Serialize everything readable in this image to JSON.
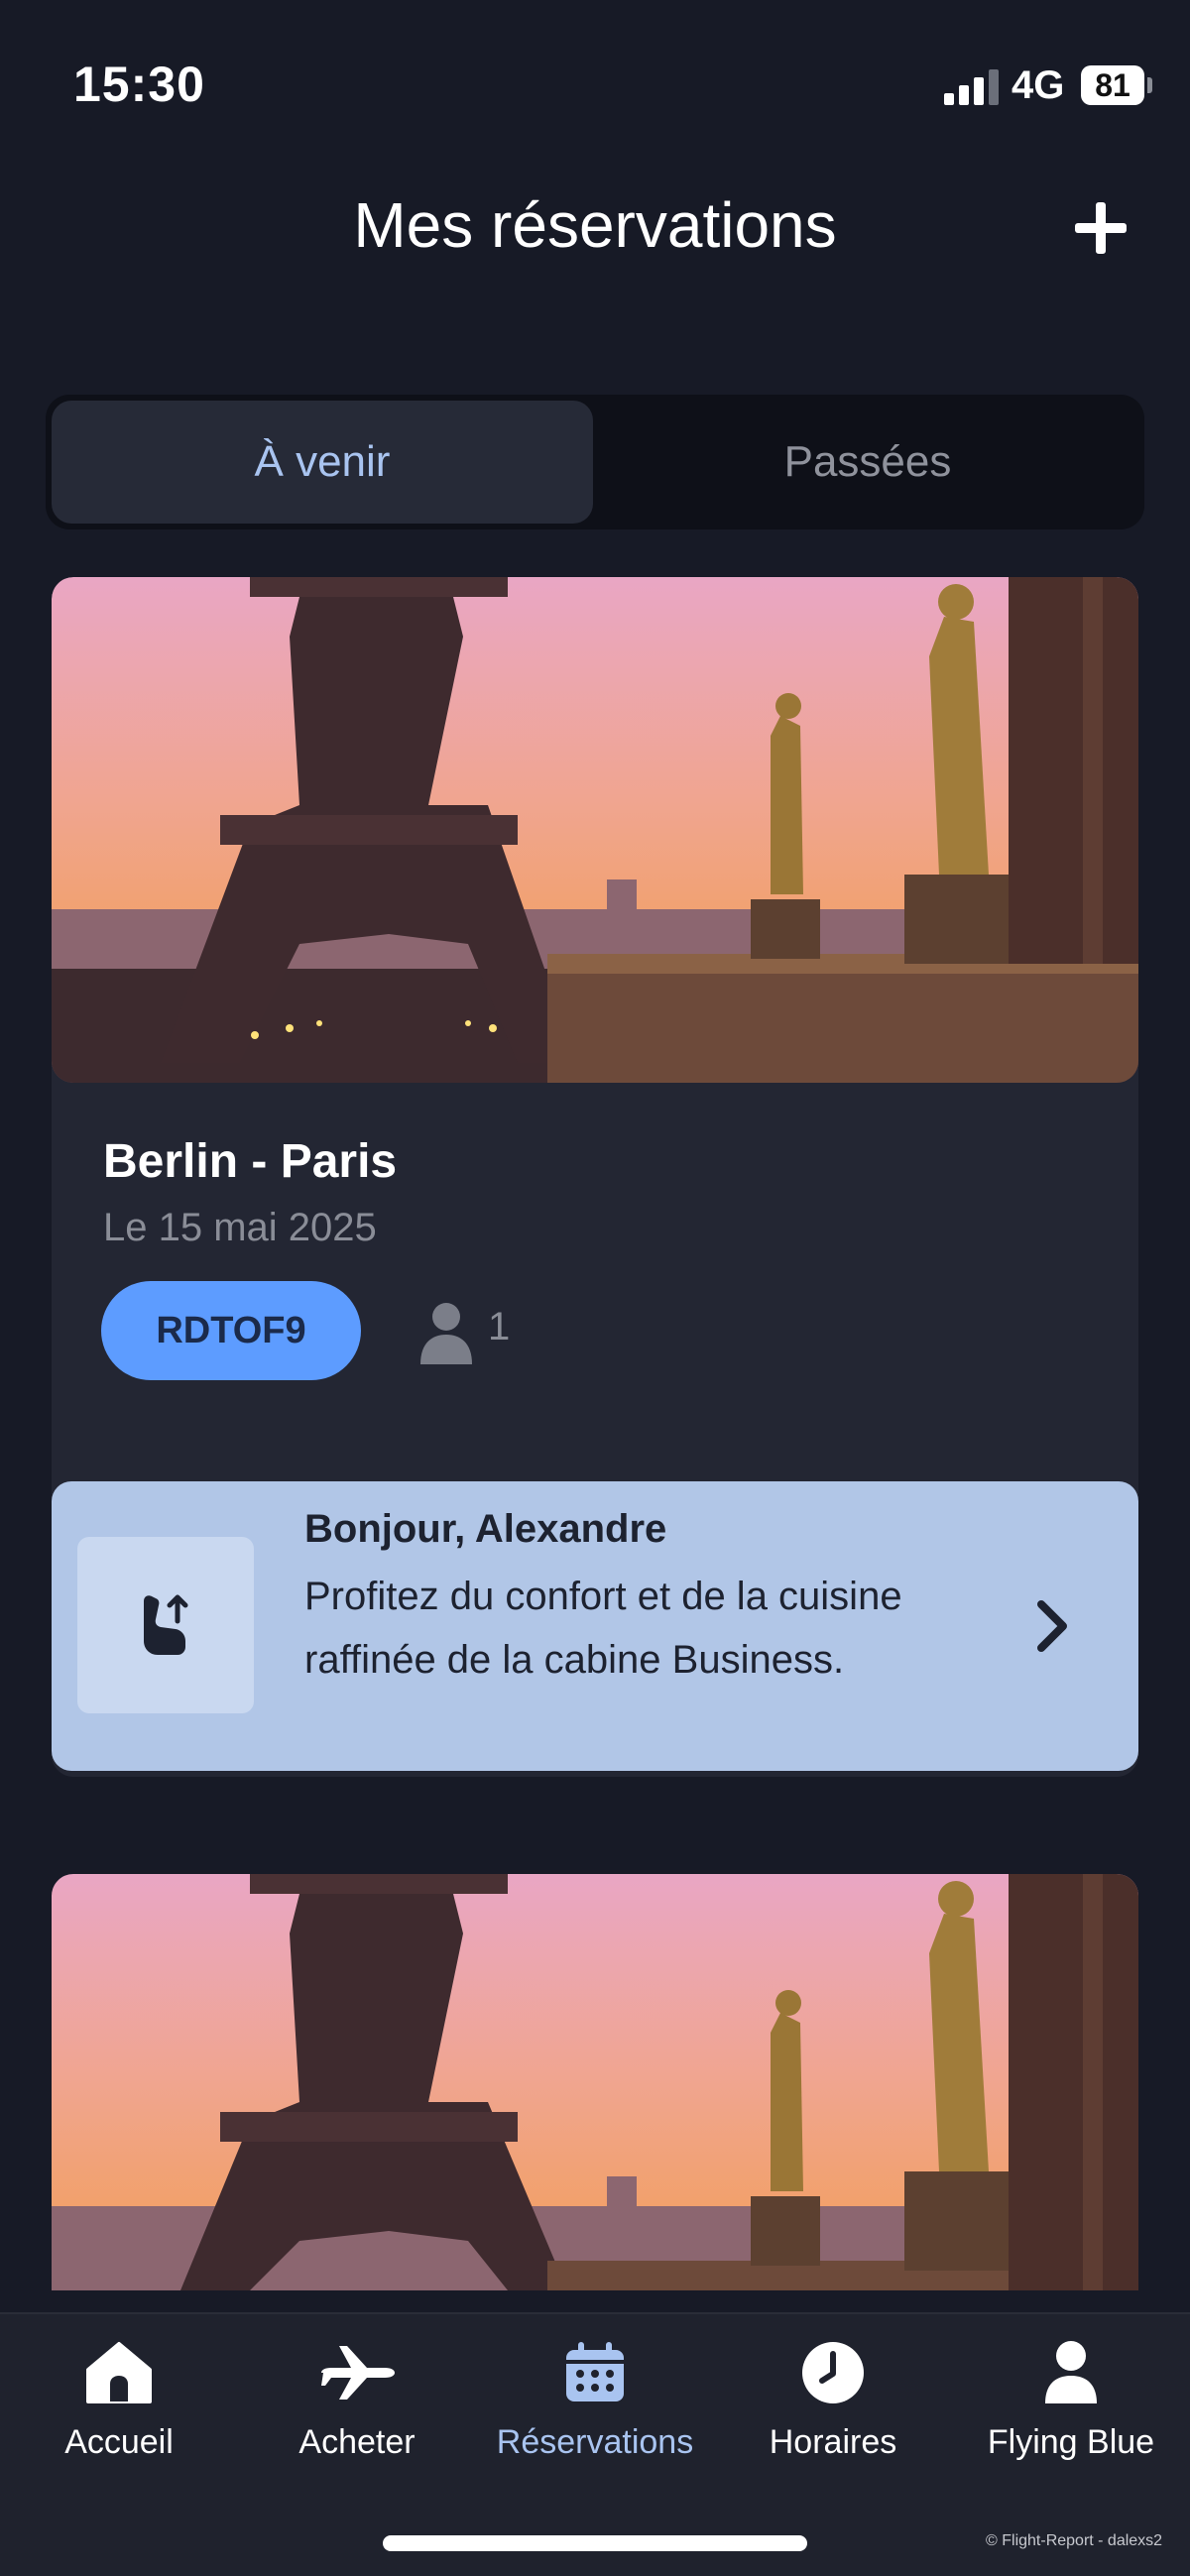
{
  "status_bar": {
    "time": "15:30",
    "network": "4G",
    "battery": "81",
    "signal_icon": "signal-bars-icon"
  },
  "header": {
    "title": "Mes réservations",
    "add_icon": "plus-icon"
  },
  "tabs": {
    "upcoming": "À venir",
    "past": "Passées",
    "selected": "upcoming"
  },
  "booking": {
    "route": "Berlin - Paris",
    "date": "Le 15 mai 2025",
    "pnr": "RDTOF9",
    "passengers": "1",
    "image": "eiffel-tower-sunset-image",
    "passenger_icon": "person-icon"
  },
  "promo": {
    "greeting": "Bonjour, Alexandre",
    "text": "Profitez du confort et de la cuisine raffinée de la cabine Business.",
    "icon": "seat-upgrade-icon",
    "chevron_icon": "chevron-right-icon"
  },
  "bottom_nav": {
    "items": [
      {
        "label": "Accueil",
        "icon": "home-icon"
      },
      {
        "label": "Acheter",
        "icon": "airplane-icon"
      },
      {
        "label": "Réservations",
        "icon": "calendar-icon"
      },
      {
        "label": "Horaires",
        "icon": "clock-icon"
      },
      {
        "label": "Flying Blue",
        "icon": "person-icon"
      }
    ],
    "active": "Réservations"
  },
  "watermark": "© Flight-Report - dalexs2",
  "colors": {
    "background": "#171a26",
    "card": "#232633",
    "accent": "#5d9cff",
    "promo_bg": "#b1c6e7",
    "active_tab": "#a9c4f0"
  }
}
